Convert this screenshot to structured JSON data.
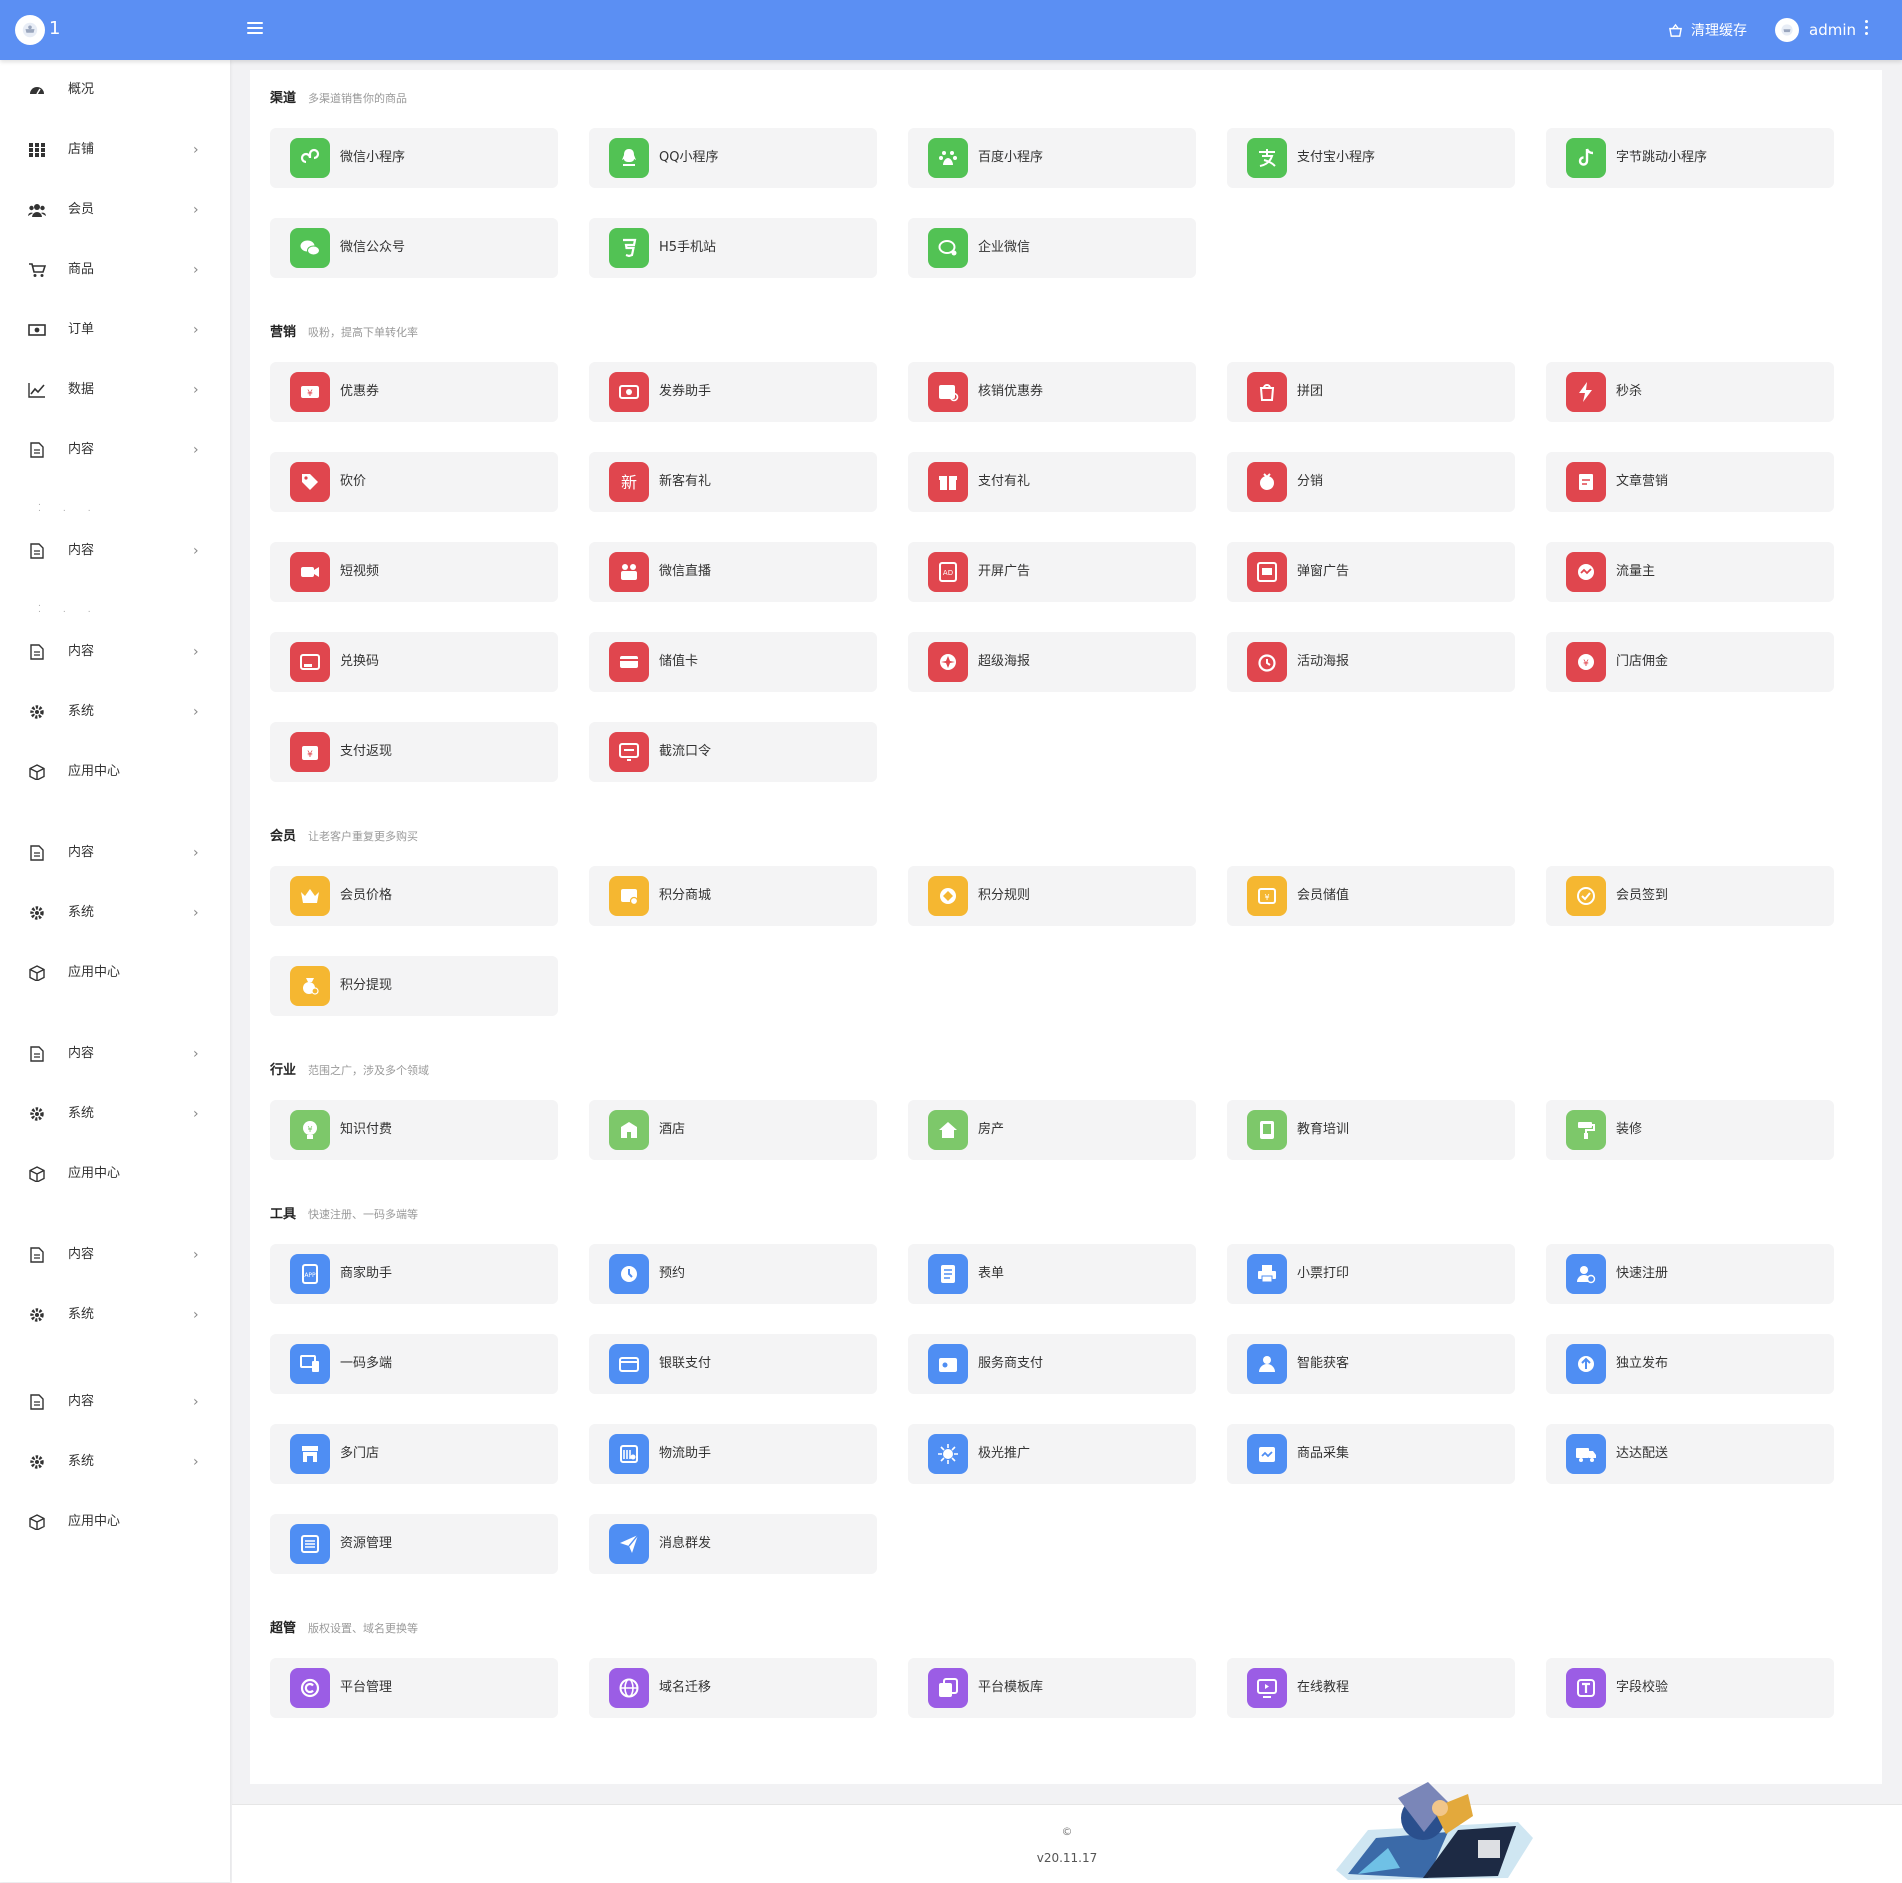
{
  "header": {
    "logo_text": "1",
    "clear_cache": "清理缓存",
    "username": "admin",
    "bg": "#5b8ff3"
  },
  "sidebar": [
    {
      "label": "概况",
      "icon": "dashboard-icon",
      "arrow": ""
    },
    {
      "label": "店铺",
      "icon": "grid-icon",
      "arrow": "›"
    },
    {
      "label": "会员",
      "icon": "users-icon",
      "arrow": "›"
    },
    {
      "label": "商品",
      "icon": "cart-icon",
      "arrow": "›"
    },
    {
      "label": "订单",
      "icon": "money-icon",
      "arrow": "›"
    },
    {
      "label": "数据",
      "icon": "chart-icon",
      "arrow": "›"
    },
    {
      "label": "内容",
      "icon": "document-icon",
      "arrow": "›"
    },
    {
      "label": "内容",
      "icon": "document-icon",
      "arrow": "›"
    },
    {
      "label": "内容",
      "icon": "document-icon",
      "arrow": "›"
    },
    {
      "label": "系统",
      "icon": "gear-icon",
      "arrow": "›"
    },
    {
      "label": "应用中心",
      "icon": "cube-icon",
      "arrow": ""
    },
    {
      "label": "内容",
      "icon": "document-icon",
      "arrow": "›"
    },
    {
      "label": "系统",
      "icon": "gear-icon",
      "arrow": "›"
    },
    {
      "label": "应用中心",
      "icon": "cube-icon",
      "arrow": ""
    },
    {
      "label": "内容",
      "icon": "document-icon",
      "arrow": "›"
    },
    {
      "label": "系统",
      "icon": "gear-icon",
      "arrow": "›"
    },
    {
      "label": "应用中心",
      "icon": "cube-icon",
      "arrow": ""
    },
    {
      "label": "内容",
      "icon": "document-icon",
      "arrow": "›"
    },
    {
      "label": "系统",
      "icon": "gear-icon",
      "arrow": "›"
    },
    {
      "label": "内容",
      "icon": "document-icon",
      "arrow": "›"
    },
    {
      "label": "系统",
      "icon": "gear-icon",
      "arrow": "›"
    },
    {
      "label": "应用中心",
      "icon": "cube-icon",
      "arrow": ""
    }
  ],
  "sections": [
    {
      "title": "渠道",
      "subtitle": "多渠道销售你的商品",
      "color": "#52c254",
      "items": [
        {
          "label": "微信小程序",
          "icon": "mini-program-icon"
        },
        {
          "label": "QQ小程序",
          "icon": "qq-icon"
        },
        {
          "label": "百度小程序",
          "icon": "baidu-icon"
        },
        {
          "label": "支付宝小程序",
          "icon": "alipay-icon"
        },
        {
          "label": "字节跳动小程序",
          "icon": "tiktok-icon"
        },
        {
          "label": "微信公众号",
          "icon": "wechat-icon"
        },
        {
          "label": "H5手机站",
          "icon": "html5-icon"
        },
        {
          "label": "企业微信",
          "icon": "work-wechat-icon"
        }
      ]
    },
    {
      "title": "营销",
      "subtitle": "吸粉，提高下单转化率",
      "color": "#e0464e",
      "items": [
        {
          "label": "优惠券",
          "icon": "coupon-icon"
        },
        {
          "label": "发券助手",
          "icon": "coupon-send-icon"
        },
        {
          "label": "核销优惠券",
          "icon": "coupon-verify-icon"
        },
        {
          "label": "拼团",
          "icon": "group-buy-icon"
        },
        {
          "label": "秒杀",
          "icon": "flash-icon"
        },
        {
          "label": "砍价",
          "icon": "bargain-icon"
        },
        {
          "label": "新客有礼",
          "icon": "new-customer-icon"
        },
        {
          "label": "支付有礼",
          "icon": "gift-icon"
        },
        {
          "label": "分销",
          "icon": "distribution-icon"
        },
        {
          "label": "文章营销",
          "icon": "article-icon"
        },
        {
          "label": "短视频",
          "icon": "video-icon"
        },
        {
          "label": "微信直播",
          "icon": "live-icon"
        },
        {
          "label": "开屏广告",
          "icon": "ad-icon"
        },
        {
          "label": "弹窗广告",
          "icon": "popup-ad-icon"
        },
        {
          "label": "流量主",
          "icon": "traffic-icon"
        },
        {
          "label": "兑换码",
          "icon": "redeem-code-icon"
        },
        {
          "label": "储值卡",
          "icon": "stored-card-icon"
        },
        {
          "label": "超级海报",
          "icon": "poster-icon"
        },
        {
          "label": "活动海报",
          "icon": "activity-poster-icon"
        },
        {
          "label": "门店佣金",
          "icon": "commission-icon"
        },
        {
          "label": "支付返现",
          "icon": "cashback-icon"
        },
        {
          "label": "截流口令",
          "icon": "password-icon"
        }
      ]
    },
    {
      "title": "会员",
      "subtitle": "让老客户重复更多购买",
      "color": "#f5b731",
      "items": [
        {
          "label": "会员价格",
          "icon": "crown-icon"
        },
        {
          "label": "积分商城",
          "icon": "points-mall-icon"
        },
        {
          "label": "积分规则",
          "icon": "points-rule-icon"
        },
        {
          "label": "会员储值",
          "icon": "member-recharge-icon"
        },
        {
          "label": "会员签到",
          "icon": "sign-in-icon"
        },
        {
          "label": "积分提现",
          "icon": "points-withdraw-icon"
        }
      ]
    },
    {
      "title": "行业",
      "subtitle": "范围之广，涉及多个领域",
      "color": "#7dc86a",
      "items": [
        {
          "label": "知识付费",
          "icon": "knowledge-icon"
        },
        {
          "label": "酒店",
          "icon": "hotel-icon"
        },
        {
          "label": "房产",
          "icon": "house-icon"
        },
        {
          "label": "教育培训",
          "icon": "education-icon"
        },
        {
          "label": "装修",
          "icon": "paint-roller-icon"
        }
      ]
    },
    {
      "title": "工具",
      "subtitle": "快速注册、一码多端等",
      "color": "#4f8ef3",
      "items": [
        {
          "label": "商家助手",
          "icon": "app-icon"
        },
        {
          "label": "预约",
          "icon": "clock-icon"
        },
        {
          "label": "表单",
          "icon": "form-icon"
        },
        {
          "label": "小票打印",
          "icon": "printer-icon"
        },
        {
          "label": "快速注册",
          "icon": "register-icon"
        },
        {
          "label": "一码多端",
          "icon": "multi-device-icon"
        },
        {
          "label": "银联支付",
          "icon": "unionpay-icon"
        },
        {
          "label": "服务商支付",
          "icon": "wallet-icon"
        },
        {
          "label": "智能获客",
          "icon": "customer-icon"
        },
        {
          "label": "独立发布",
          "icon": "publish-icon"
        },
        {
          "label": "多门店",
          "icon": "store-icon"
        },
        {
          "label": "物流助手",
          "icon": "logistics-icon"
        },
        {
          "label": "极光推广",
          "icon": "aurora-icon"
        },
        {
          "label": "商品采集",
          "icon": "collect-icon"
        },
        {
          "label": "达达配送",
          "icon": "truck-icon"
        },
        {
          "label": "资源管理",
          "icon": "resource-icon"
        },
        {
          "label": "消息群发",
          "icon": "send-icon"
        }
      ]
    },
    {
      "title": "超管",
      "subtitle": "版权设置、域名更换等",
      "color": "#9b5de5",
      "items": [
        {
          "label": "平台管理",
          "icon": "copyright-icon"
        },
        {
          "label": "域名迁移",
          "icon": "globe-icon"
        },
        {
          "label": "平台模板库",
          "icon": "template-icon"
        },
        {
          "label": "在线教程",
          "icon": "tutorial-icon"
        },
        {
          "label": "字段校验",
          "icon": "field-check-icon"
        }
      ]
    }
  ],
  "footer": {
    "copyright": "©",
    "version": "v20.11.17"
  }
}
